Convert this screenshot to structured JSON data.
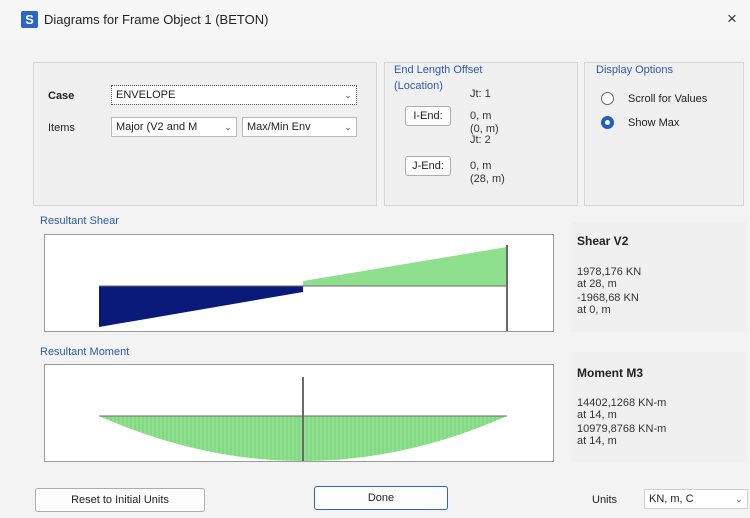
{
  "window": {
    "app_icon_letter": "S",
    "title": "Diagrams for Frame Object 1  (BETON)",
    "close_glyph": "×"
  },
  "selection": {
    "case_label": "Case",
    "case_value": "ENVELOPE",
    "items_label": "Items",
    "items_value": "Major (V2 and M",
    "envelope_value": "Max/Min Env"
  },
  "end_length_offset": {
    "title": "End Length Offset",
    "location_label": "(Location)",
    "i_end_button": "I-End:",
    "i_jt": "Jt: 1",
    "i_value": "0, m",
    "i_location": "(0, m)",
    "j_end_button": "J-End:",
    "j_jt": "Jt: 2",
    "j_value": "0, m",
    "j_location": "(28, m)"
  },
  "display_options": {
    "title": "Display Options",
    "scroll_label": "Scroll for Values",
    "show_max_label": "Show Max",
    "selected": "Show Max"
  },
  "shear": {
    "section_title": "Resultant Shear",
    "result_title": "Shear V2",
    "max_value": "1978,176 KN",
    "max_at": "at 28, m",
    "min_value": "-1968,68 KN",
    "min_at": "at 0, m",
    "positive_color": "#8ee08e",
    "negative_color": "#0a1a7a",
    "diagram": {
      "member_length": 28,
      "values_at_ends": [
        -1968.68,
        1978.176
      ]
    }
  },
  "moment": {
    "section_title": "Resultant Moment",
    "result_title": "Moment M3",
    "max_value": "14402,1268 KN-m",
    "max_at": "at 14, m",
    "min_value": "10979,8768 KN-m",
    "min_at": "at 14, m",
    "fill_color": "#8ee08e",
    "diagram": {
      "member_length": 28,
      "peak_value": 14402.1268,
      "peak_at": 14
    }
  },
  "footer": {
    "reset_button": "Reset to Initial Units",
    "done_button": "Done",
    "units_label": "Units",
    "units_value": "KN, m, C"
  }
}
